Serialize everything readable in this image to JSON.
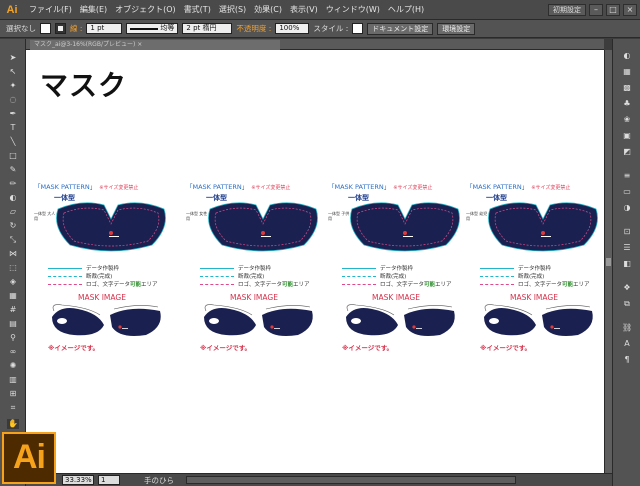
{
  "app": {
    "logo": "Ai",
    "menus": [
      "ファイル(F)",
      "編集(E)",
      "オブジェクト(O)",
      "書式(T)",
      "選択(S)",
      "効果(C)",
      "表示(V)",
      "ウィンドウ(W)",
      "ヘルプ(H)"
    ],
    "workspace": "初期設定",
    "window_buttons": [
      "–",
      "□",
      "×"
    ]
  },
  "control_bar": {
    "selection": "選択なし",
    "stroke_label": "線 :",
    "stroke_weight": "1 pt",
    "profile": "均等",
    "brush": "2 pt 楕円",
    "opacity_label": "不透明度 :",
    "opacity": "100%",
    "style_label": "スタイル :",
    "doc_setup": "ドキュメント設定",
    "prefs": "環境設定"
  },
  "document_tab": "マスク_ai@3-16%(RGB/プレビュー)  ×",
  "canvas": {
    "title": "マスク",
    "mockups": [
      {
        "pattern_title": "「MASK PATTERN」",
        "pattern_note": "※サイズ変更禁止",
        "type": "一体型",
        "side_note": "一体型 大人用",
        "legend_1": "データ作製枠",
        "legend_2": "断裁(完成)",
        "legend_3a": "ロゴ、文字データ",
        "legend_3b": "可能",
        "legend_3c": "エリア",
        "image_title": "MASK IMAGE",
        "image_note": "※イメージです。"
      },
      {
        "pattern_title": "「MASK PATTERN」",
        "pattern_note": "※サイズ変更禁止",
        "type": "一体型",
        "side_note": "一体型 女性用",
        "legend_1": "データ作製枠",
        "legend_2": "断裁(完成)",
        "legend_3a": "ロゴ、文字データ",
        "legend_3b": "可能",
        "legend_3c": "エリア",
        "image_title": "MASK IMAGE",
        "image_note": "※イメージです。"
      },
      {
        "pattern_title": "「MASK PATTERN」",
        "pattern_note": "※サイズ変更禁止",
        "type": "一体型",
        "side_note": "一体型 子供用",
        "legend_1": "データ作製枠",
        "legend_2": "断裁(完成)",
        "legend_3a": "ロゴ、文字データ",
        "legend_3b": "可能",
        "legend_3c": "エリア",
        "image_title": "MASK IMAGE",
        "image_note": "※イメージです。"
      },
      {
        "pattern_title": "「MASK PATTERN」",
        "pattern_note": "※サイズ変更禁止",
        "type": "一体型",
        "side_note": "一体型 幼児用",
        "legend_1": "データ作製枠",
        "legend_2": "断裁(完成)",
        "legend_3a": "ロゴ、文字データ",
        "legend_3b": "可能",
        "legend_3c": "エリア",
        "image_title": "MASK IMAGE",
        "image_note": "※イメージです。"
      }
    ]
  },
  "status": {
    "zoom": "33.33%",
    "page": "1",
    "tool": "手のひら"
  },
  "colors": {
    "mask_navy": "#1a2150",
    "accent_orange": "#f7a21b",
    "cut_line": "#23b5c8",
    "safe_line": "#e04a8a"
  }
}
